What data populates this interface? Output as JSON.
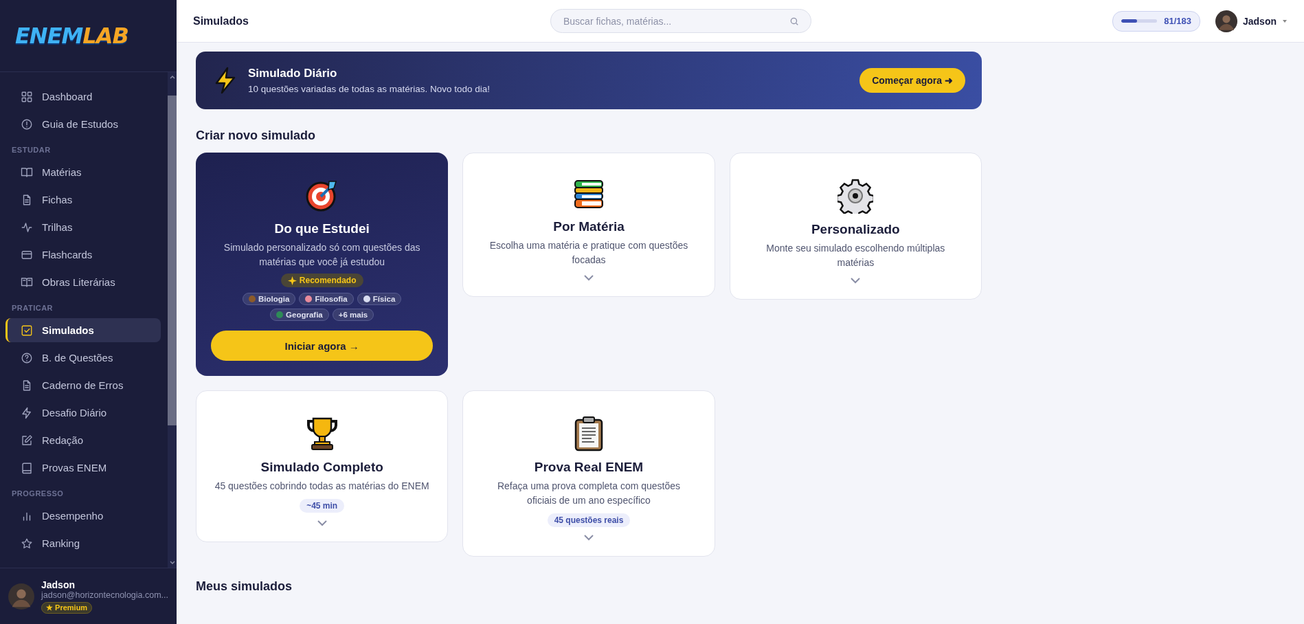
{
  "sidebar": {
    "logo": [
      "ENEM",
      "LAB"
    ],
    "sections": [
      {
        "items": [
          {
            "label": "Dashboard",
            "selected": false
          },
          {
            "label": "Guia de Estudos",
            "selected": false
          }
        ]
      },
      {
        "label": "ESTUDAR",
        "items": [
          {
            "label": "Matérias",
            "selected": false
          },
          {
            "label": "Fichas",
            "selected": false
          },
          {
            "label": "Trilhas",
            "selected": false
          },
          {
            "label": "Flashcards",
            "selected": false
          },
          {
            "label": "Obras Literárias",
            "selected": false
          }
        ]
      },
      {
        "label": "PRATICAR",
        "items": [
          {
            "label": "Simulados",
            "selected": true
          },
          {
            "label": "B. de Questões",
            "selected": false
          },
          {
            "label": "Caderno de Erros",
            "selected": false
          },
          {
            "label": "Desafio Diário",
            "selected": false
          },
          {
            "label": "Redação",
            "selected": false
          },
          {
            "label": "Provas ENEM",
            "selected": false
          }
        ]
      },
      {
        "label": "PROGRESSO",
        "items": [
          {
            "label": "Desempenho",
            "selected": false
          },
          {
            "label": "Ranking",
            "selected": false
          }
        ]
      }
    ],
    "user": {
      "name": "Jadson",
      "email": "jadson@horizontecnologia.com...",
      "plan": "★ Premium"
    }
  },
  "topbar": {
    "title": "Simulados",
    "search": {
      "placeholder": "Buscar fichas, matérias..."
    },
    "progress": {
      "level": 0.44,
      "reading": "81/183"
    },
    "user": "Jadson"
  },
  "hero": {
    "title": "Simulado Diário",
    "subtitle": "10 questões variadas de todas as matérias. Novo todo dia!",
    "button": "Começar agora ➜"
  },
  "create_heading": "Criar novo simulado",
  "cards": [
    {
      "kind": "featured",
      "title": "Do que Estudei",
      "description": "Simulado personalizado só com questões das matérias que você já estudou",
      "badge": "Recomendado",
      "tags": [
        {
          "kind": "subject",
          "label": "Biologia",
          "color": "#8b5a2b"
        },
        {
          "kind": "subject",
          "label": "Filosofia",
          "color": "#e88b9c"
        },
        {
          "kind": "subject",
          "label": "Física",
          "color": "#d8dcf0"
        },
        {
          "kind": "subject",
          "label": "Geografia",
          "color": "#2e8b57"
        },
        {
          "kind": "more",
          "label": "+6 mais"
        }
      ],
      "button": "Iniciar agora →"
    },
    {
      "kind": "standard",
      "title": "Por Matéria",
      "description": "Escolha uma matéria e pratique com questões focadas"
    },
    {
      "kind": "standard",
      "title": "Personalizado",
      "description": "Monte seu simulado escolhendo múltiplas matérias"
    },
    {
      "kind": "standard",
      "title": "Simulado Completo",
      "description": "45 questões cobrindo todas as matérias do ENEM",
      "badge": "~45 min"
    },
    {
      "kind": "standard",
      "title": "Prova Real ENEM",
      "description": "Refaça uma prova completa com questões oficiais de um ano específico",
      "badge": "45 questões reais"
    }
  ],
  "my_heading": "Meus simulados"
}
